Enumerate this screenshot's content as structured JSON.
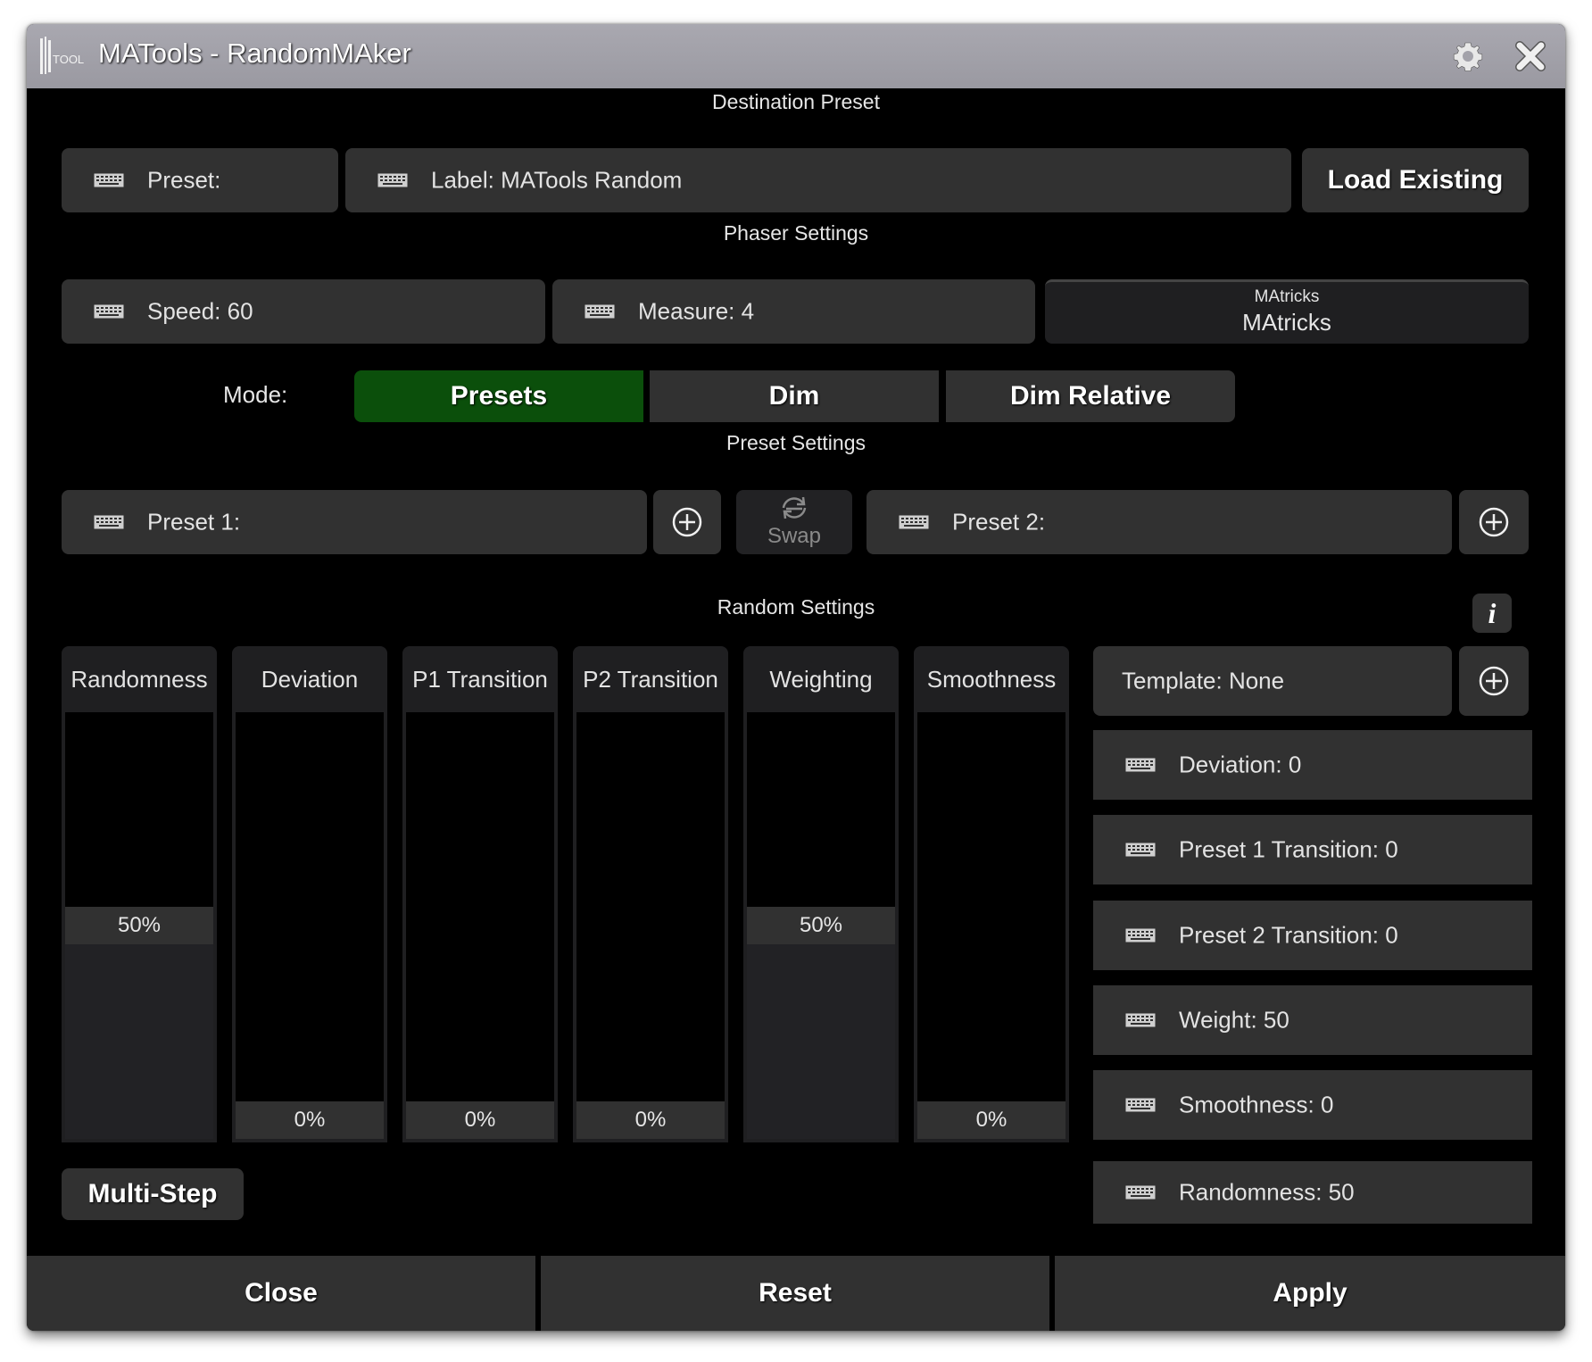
{
  "window": {
    "title": "MATools - RandomMAker",
    "logo_text": "TOOLS",
    "icons": [
      "gear-icon",
      "close-icon"
    ]
  },
  "destination": {
    "section_label": "Destination Preset",
    "preset_field": "Preset:",
    "label_field": "Label: MATools Random",
    "load_button": "Load Existing"
  },
  "phaser": {
    "section_label": "Phaser Settings",
    "speed_field": "Speed: 60",
    "measure_field": "Measure: 4",
    "matricks_title": "MAtricks",
    "matricks_value": "MAtricks"
  },
  "mode": {
    "label": "Mode:",
    "options": [
      "Presets",
      "Dim",
      "Dim Relative"
    ],
    "selected": "Presets",
    "accent_color": "#0b4f0b"
  },
  "preset_settings": {
    "section_label": "Preset Settings",
    "preset1_field": "Preset 1:",
    "swap_label": "Swap",
    "preset2_field": "Preset 2:"
  },
  "random": {
    "section_label": "Random Settings",
    "info_icon": "i",
    "faders": [
      {
        "label": "Randomness",
        "value_text": "50%",
        "level": 0.5
      },
      {
        "label": "Deviation",
        "value_text": "0%",
        "level": 0
      },
      {
        "label": "P1 Transition",
        "value_text": "0%",
        "level": 0
      },
      {
        "label": "P2 Transition",
        "value_text": "0%",
        "level": 0
      },
      {
        "label": "Weighting",
        "value_text": "50%",
        "level": 0.5
      },
      {
        "label": "Smoothness",
        "value_text": "0%",
        "level": 0
      }
    ],
    "template_field": "Template: None",
    "value_fields": [
      "Deviation: 0",
      "Preset 1 Transition: 0",
      "Preset 2 Transition: 0",
      "Weight: 50",
      "Smoothness: 0",
      "Randomness: 50"
    ],
    "multistep_button": "Multi-Step"
  },
  "footer": {
    "close": "Close",
    "reset": "Reset",
    "apply": "Apply"
  }
}
